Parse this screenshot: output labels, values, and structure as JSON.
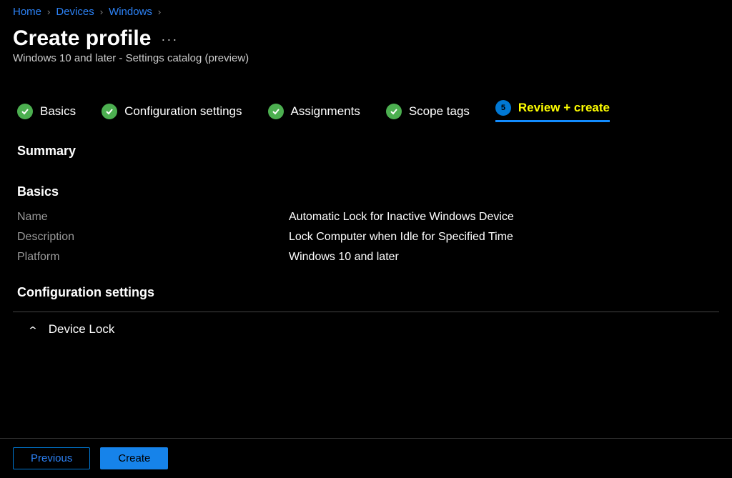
{
  "breadcrumb": {
    "home": "Home",
    "devices": "Devices",
    "windows": "Windows"
  },
  "header": {
    "title": "Create profile",
    "subtitle": "Windows 10 and later - Settings catalog (preview)"
  },
  "steps": {
    "basics": "Basics",
    "config": "Configuration settings",
    "assignments": "Assignments",
    "scope": "Scope tags",
    "review_num": "5",
    "review": "Review + create"
  },
  "summary": {
    "heading": "Summary",
    "basics_title": "Basics",
    "fields": {
      "name_label": "Name",
      "name_value": "Automatic Lock for Inactive Windows Device",
      "desc_label": "Description",
      "desc_value": "Lock Computer when Idle for Specified Time",
      "platform_label": "Platform",
      "platform_value": "Windows 10 and later"
    },
    "config_title": "Configuration settings",
    "accordion_title": "Device Lock"
  },
  "footer": {
    "previous": "Previous",
    "create": "Create"
  }
}
